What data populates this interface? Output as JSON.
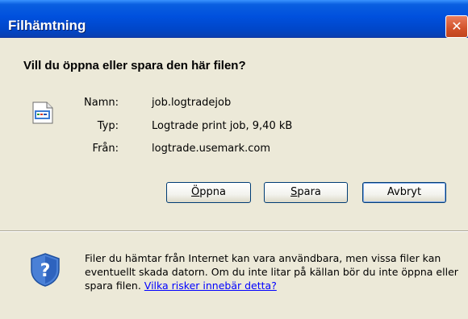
{
  "window": {
    "title": "Filhämtning",
    "close_glyph": "✕"
  },
  "dialog": {
    "question": "Vill du öppna eller spara den här filen?",
    "file_icon": "file-document-icon",
    "fields": [
      {
        "label": "Namn:",
        "value": "job.logtradejob"
      },
      {
        "label": "Typ:",
        "value": "Logtrade print job, 9,40 kB"
      },
      {
        "label": "Från:",
        "value": "logtrade.usemark.com"
      }
    ],
    "buttons": {
      "open_prefix": "Ö",
      "open_rest": "ppna",
      "save_prefix": "S",
      "save_rest": "para",
      "cancel_label": "Avbryt"
    },
    "warning": {
      "icon": "shield-question-icon",
      "text": "Filer du hämtar från Internet kan vara användbara, men vissa filer kan eventuellt skada datorn. Om du inte litar på källan bör du inte öppna eller spara filen.",
      "link": "Vilka risker innebär detta?"
    }
  },
  "colors": {
    "titlebar": "#0050DD",
    "dialog_bg": "#ECE9D8",
    "link": "#0000FF"
  }
}
